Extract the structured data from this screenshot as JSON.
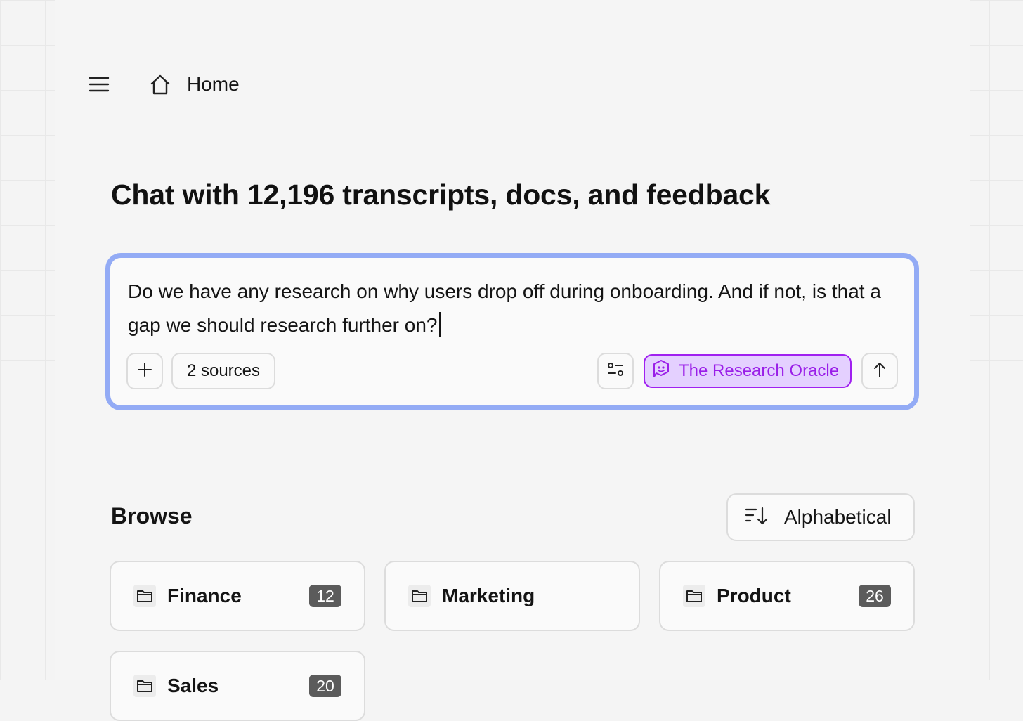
{
  "nav": {
    "home_label": "Home"
  },
  "title": "Chat with 12,196 transcripts, docs, and feedback",
  "composer": {
    "text": "Do we have any research on why users drop off during onboarding. And if not, is that a gap we should research further on?",
    "sources_label": "2 sources",
    "agent_label": "The Research Oracle"
  },
  "browse": {
    "title": "Browse",
    "sort_label": "Alphabetical",
    "folders": [
      {
        "name": "Finance",
        "count": "12"
      },
      {
        "name": "Marketing",
        "count": ""
      },
      {
        "name": "Product",
        "count": "26"
      },
      {
        "name": "Sales",
        "count": "20"
      }
    ]
  },
  "colors": {
    "composer_border": "#93abf5",
    "agent_accent": "#9a1ee8",
    "agent_bg": "#e4d0ff",
    "badge_bg": "#5b5b5b"
  },
  "icons": [
    "menu-icon",
    "home-icon",
    "plus-icon",
    "settings-sliders-icon",
    "oracle-icon",
    "arrow-up-icon",
    "sort-icon",
    "folder-icon"
  ]
}
